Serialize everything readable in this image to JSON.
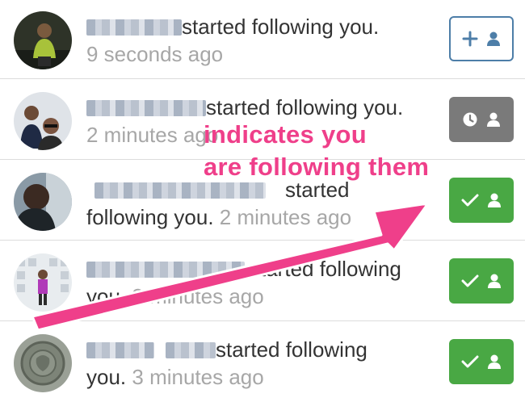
{
  "notifications": [
    {
      "name_redacted": true,
      "message": "started following you.",
      "time": "9 seconds ago",
      "button": "follow",
      "button_icons": [
        "plus-icon",
        "person-icon"
      ]
    },
    {
      "name_redacted": true,
      "message": "started following you.",
      "time": "2 minutes ago",
      "button": "requested",
      "button_icons": [
        "clock-icon",
        "person-icon"
      ]
    },
    {
      "name_redacted": true,
      "message_line1": "started",
      "message_line2": "following you.",
      "time": "2 minutes ago",
      "button": "following",
      "button_icons": [
        "check-icon",
        "person-icon"
      ]
    },
    {
      "name_redacted": true,
      "message_line1": "started following",
      "message_line2": "you.",
      "time": "3 minutes ago",
      "button": "following",
      "button_icons": [
        "check-icon",
        "person-icon"
      ]
    },
    {
      "name_redacted": true,
      "message_line1": "started following",
      "message_line2": "you.",
      "time": "3 minutes ago",
      "button": "following",
      "button_icons": [
        "check-icon",
        "person-icon"
      ]
    }
  ],
  "annotation": {
    "line1": "indicates you",
    "line2": "are following them",
    "color": "#ef3f8a"
  },
  "colors": {
    "follow_outline": "#4d7ea8",
    "requested_gray": "#7a7a7a",
    "following_green": "#49a844",
    "timestamp_gray": "#a7a7a7"
  }
}
